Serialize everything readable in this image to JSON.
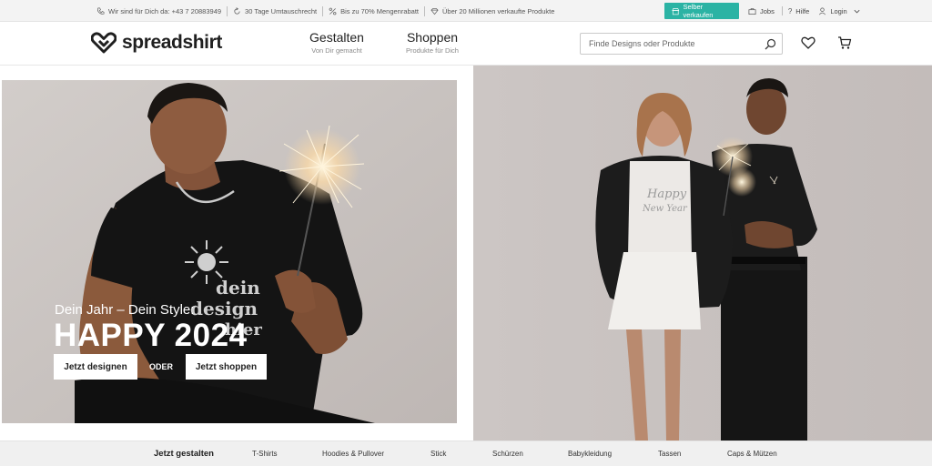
{
  "topbar": {
    "items": [
      {
        "icon": "phone-icon",
        "text": "Wir sind für Dich da: +43 7 20883949"
      },
      {
        "icon": "return-icon",
        "text": "30 Tage Umtauschrecht"
      },
      {
        "icon": "percent-icon",
        "text": "Bis zu 70% Mengenrabatt"
      },
      {
        "icon": "diamond-icon",
        "text": "Über 20 Millionen verkaufte Produkte"
      }
    ],
    "sell_label": "Selber verkaufen",
    "jobs_label": "Jobs",
    "help_label": "Hilfe",
    "login_label": "Login"
  },
  "header": {
    "logo_text": "spreadshirt",
    "nav": [
      {
        "label": "Gestalten",
        "sub": "Von Dir gemacht"
      },
      {
        "label": "Shoppen",
        "sub": "Produkte für Dich"
      }
    ],
    "search_placeholder": "Finde Designs oder Produkte"
  },
  "hero": {
    "kicker": "Dein Jahr – Dein Style:",
    "title": "HAPPY 2024",
    "shirt_print": [
      "dein",
      "design",
      "hier"
    ],
    "button_design": "Jetzt designen",
    "or_label": "ODER",
    "button_shop": "Jetzt shoppen",
    "right_shirt_print": [
      "Happy",
      "New Year"
    ]
  },
  "categories": [
    "Jetzt gestalten",
    "T-Shirts",
    "Hoodies & Pullover",
    "Stick",
    "Schürzen",
    "Babykleidung",
    "Tassen",
    "Caps & Mützen"
  ],
  "colors": {
    "accent": "#2bb3a4",
    "topbar_bg": "#f3f3f3",
    "hero_bg": "#c8c2c0"
  }
}
